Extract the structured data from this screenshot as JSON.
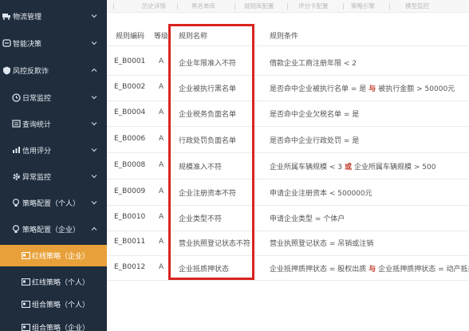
{
  "sidebar": {
    "items": [
      {
        "label": "物流管理",
        "icon": "truck-icon",
        "expanded": false
      },
      {
        "label": "智能决策",
        "icon": "brain-icon",
        "expanded": false
      },
      {
        "label": "风控反欺诈",
        "icon": "shield-icon",
        "expanded": true
      },
      {
        "label": "日常监控",
        "icon": "clock-icon",
        "expanded": false
      },
      {
        "label": "查询统计",
        "icon": "list-icon",
        "expanded": false
      },
      {
        "label": "信用评分",
        "icon": "chart-icon",
        "expanded": false
      },
      {
        "label": "异常监控",
        "icon": "gear-icon",
        "expanded": false
      },
      {
        "label": "策略配置（个人）",
        "icon": "bulb-icon",
        "expanded": false
      },
      {
        "label": "策略配置（企业）",
        "icon": "bulb-icon",
        "expanded": true
      },
      {
        "label": "红线策略（企业）",
        "icon": "card-icon",
        "active": true
      },
      {
        "label": "红线策略（个人）",
        "icon": "card-icon"
      },
      {
        "label": "组合策略（个人）",
        "icon": "card-icon"
      },
      {
        "label": "组合策略（企业）",
        "icon": "card-icon"
      }
    ]
  },
  "tabs": [
    "历史详情",
    "黑名单库",
    "规则库配置",
    "评分卡配置",
    "策略引擎",
    "模型监控"
  ],
  "table": {
    "headers": {
      "code": "规则编码",
      "level": "等级",
      "name": "规则名称",
      "condition": "规则条件"
    },
    "rows": [
      {
        "code": "E_B0001",
        "level": "A",
        "name": "企业年限准入不符",
        "cond": [
          "借款企业工商注册年限 < 2"
        ]
      },
      {
        "code": "E_B0002",
        "level": "A",
        "name": "企业被执行黑名单",
        "cond": [
          "是否命中企业被执行名单 = 是",
          "与",
          "被执行金额 > 50000元"
        ]
      },
      {
        "code": "E_B0004",
        "level": "A",
        "name": "企业税务负面名单",
        "cond": [
          "是否命中企业欠税名单 = 是"
        ]
      },
      {
        "code": "E_B0006",
        "level": "A",
        "name": "行政处罚负面名单",
        "cond": [
          "是否命中企业行政处罚 = 是"
        ]
      },
      {
        "code": "E_B0008",
        "level": "A",
        "name": "规模准入不符",
        "cond": [
          "企业所属车辆规模 < 3",
          "或",
          "企业所属车辆规模 > 500"
        ]
      },
      {
        "code": "E_B0009",
        "level": "A",
        "name": "企业注册资本不符",
        "cond": [
          "申请企业注册资本 < 500000元"
        ]
      },
      {
        "code": "E_B0010",
        "level": "A",
        "name": "企业类型不符",
        "cond": [
          "申请企业类型 = 个体户"
        ]
      },
      {
        "code": "E_B0011",
        "level": "A",
        "name": "营业执照登记状态不符",
        "cond": [
          "营业执照登记状态 = 吊销或注销"
        ]
      },
      {
        "code": "E_B0012",
        "level": "A",
        "name": "企业抵质押状态",
        "cond": [
          "企业抵押质押状态 = 股权出质",
          "与",
          "企业抵押质押状态 = 动产抵押"
        ]
      }
    ]
  },
  "colors": {
    "sidebar": "#1f2d3d",
    "active": "#e8a13a",
    "highlight": "#d9231f"
  }
}
